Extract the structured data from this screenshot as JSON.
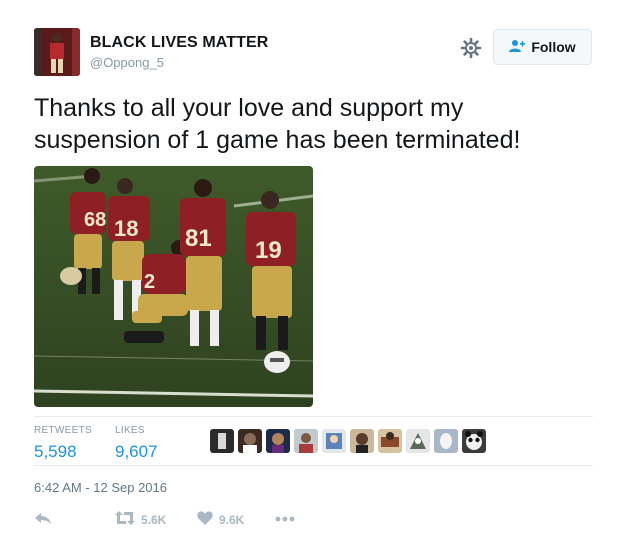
{
  "user": {
    "display_name": "BLACK LIVES MATTER",
    "handle": "@Oppong_5"
  },
  "follow_label": "Follow",
  "tweet_text": "Thanks to all your love and support my suspension of 1 game has been terminated!",
  "photo": {
    "jersey_numbers": [
      "68",
      "18",
      "81",
      "19",
      "2"
    ]
  },
  "stats": {
    "retweets_label": "RETWEETS",
    "retweets_value": "5,598",
    "likes_label": "LIKES",
    "likes_value": "9,607"
  },
  "timestamp": "6:42 AM - 12 Sep 2016",
  "actions": {
    "retweet_count": "5.6K",
    "like_count": "9.6K"
  },
  "colors": {
    "link_blue": "#1b95e0",
    "muted_gray": "#8899a6",
    "jersey_maroon": "#8e1f24",
    "pants_gold": "#c9a84c"
  }
}
